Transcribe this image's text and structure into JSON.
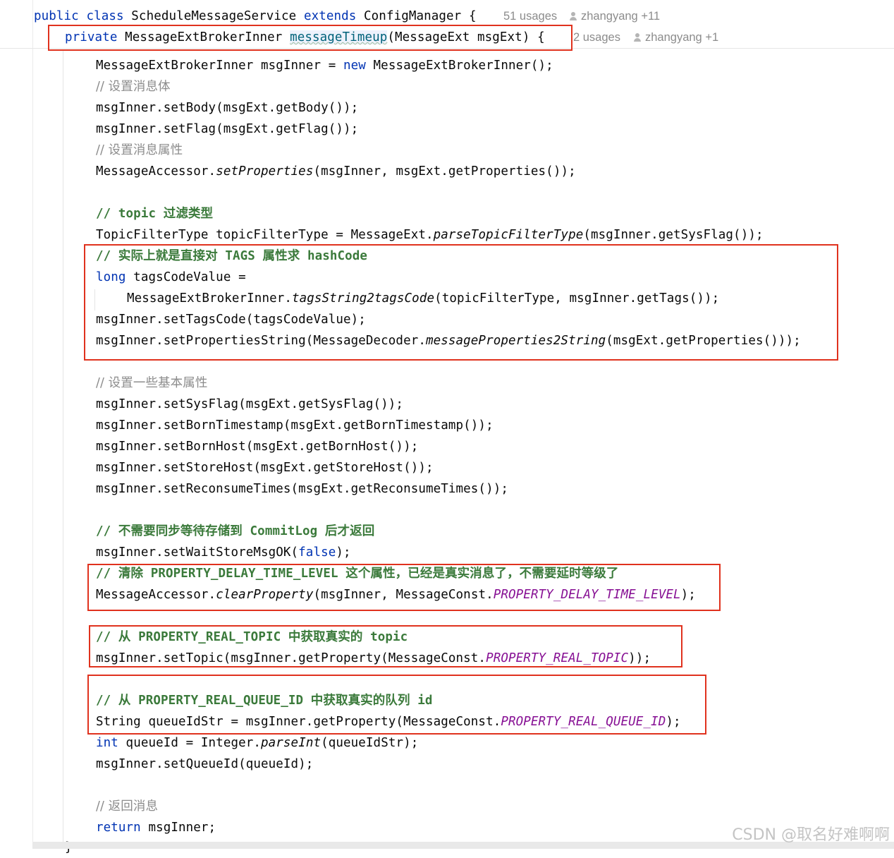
{
  "editor": {
    "class_header": {
      "kw_public": "public",
      "kw_class": "class",
      "class_name": "ScheduleMessageService",
      "kw_extends": "extends",
      "super_name": "ConfigManager",
      "brace": "{",
      "usages": "51 usages",
      "author": "zhangyang +11"
    },
    "method_header": {
      "kw_private": "private",
      "return_type": "MessageExtBrokerInner",
      "method_name": "messageTimeup",
      "params": "(MessageExt msgExt) {",
      "usages": "2 usages",
      "author": "zhangyang +1"
    },
    "lines": {
      "l1_a": "MessageExtBrokerInner msgInner = ",
      "l1_kw": "new",
      "l1_b": " MessageExtBrokerInner();",
      "l2": "// 设置消息体",
      "l3": "msgInner.setBody(msgExt.getBody());",
      "l4": "msgInner.setFlag(msgExt.getFlag());",
      "l5": "// 设置消息属性",
      "l6_a": "MessageAccessor.",
      "l6_i": "setProperties",
      "l6_b": "(msgInner, msgExt.getProperties());",
      "l7": "// topic 过滤类型",
      "l8_a": "TopicFilterType topicFilterType = MessageExt.",
      "l8_i": "parseTopicFilterType",
      "l8_b": "(msgInner.getSysFlag());",
      "l9": "// 实际上就是直接对 TAGS 属性求 hashCode",
      "l10_kw": "long",
      "l10_b": " tagsCodeValue =",
      "l11_a": "MessageExtBrokerInner.",
      "l11_i": "tagsString2tagsCode",
      "l11_b": "(topicFilterType, msgInner.getTags());",
      "l12": "msgInner.setTagsCode(tagsCodeValue);",
      "l13_a": "msgInner.setPropertiesString(MessageDecoder.",
      "l13_i": "messageProperties2String",
      "l13_b": "(msgExt.getProperties()));",
      "l14": "// 设置一些基本属性",
      "l15": "msgInner.setSysFlag(msgExt.getSysFlag());",
      "l16": "msgInner.setBornTimestamp(msgExt.getBornTimestamp());",
      "l17": "msgInner.setBornHost(msgExt.getBornHost());",
      "l18": "msgInner.setStoreHost(msgExt.getStoreHost());",
      "l19": "msgInner.setReconsumeTimes(msgExt.getReconsumeTimes());",
      "l20": "// 不需要同步等待存储到 CommitLog 后才返回",
      "l21_a": "msgInner.setWaitStoreMsgOK(",
      "l21_kw": "false",
      "l21_b": ");",
      "l22": "// 清除 PROPERTY_DELAY_TIME_LEVEL 这个属性，已经是真实消息了，不需要延时等级了",
      "l23_a": "MessageAccessor.",
      "l23_i": "clearProperty",
      "l23_b": "(msgInner, MessageConst.",
      "l23_c": "PROPERTY_DELAY_TIME_LEVEL",
      "l23_d": ");",
      "l24": "// 从 PROPERTY_REAL_TOPIC 中获取真实的 topic",
      "l25_a": "msgInner.setTopic(msgInner.getProperty(MessageConst.",
      "l25_c": "PROPERTY_REAL_TOPIC",
      "l25_d": "));",
      "l26": "// 从 PROPERTY_REAL_QUEUE_ID 中获取真实的队列 id",
      "l27_a": "String queueIdStr = msgInner.getProperty(MessageConst.",
      "l27_c": "PROPERTY_REAL_QUEUE_ID",
      "l27_d": ");",
      "l28_kw": "int",
      "l28_a": " queueId = Integer.",
      "l28_i": "parseInt",
      "l28_b": "(queueIdStr);",
      "l29": "msgInner.setQueueId(queueId);",
      "l30": "// 返回消息",
      "l31_kw": "return",
      "l31_b": " msgInner;",
      "l32": "}"
    },
    "watermark": "CSDN @取名好难啊啊"
  }
}
